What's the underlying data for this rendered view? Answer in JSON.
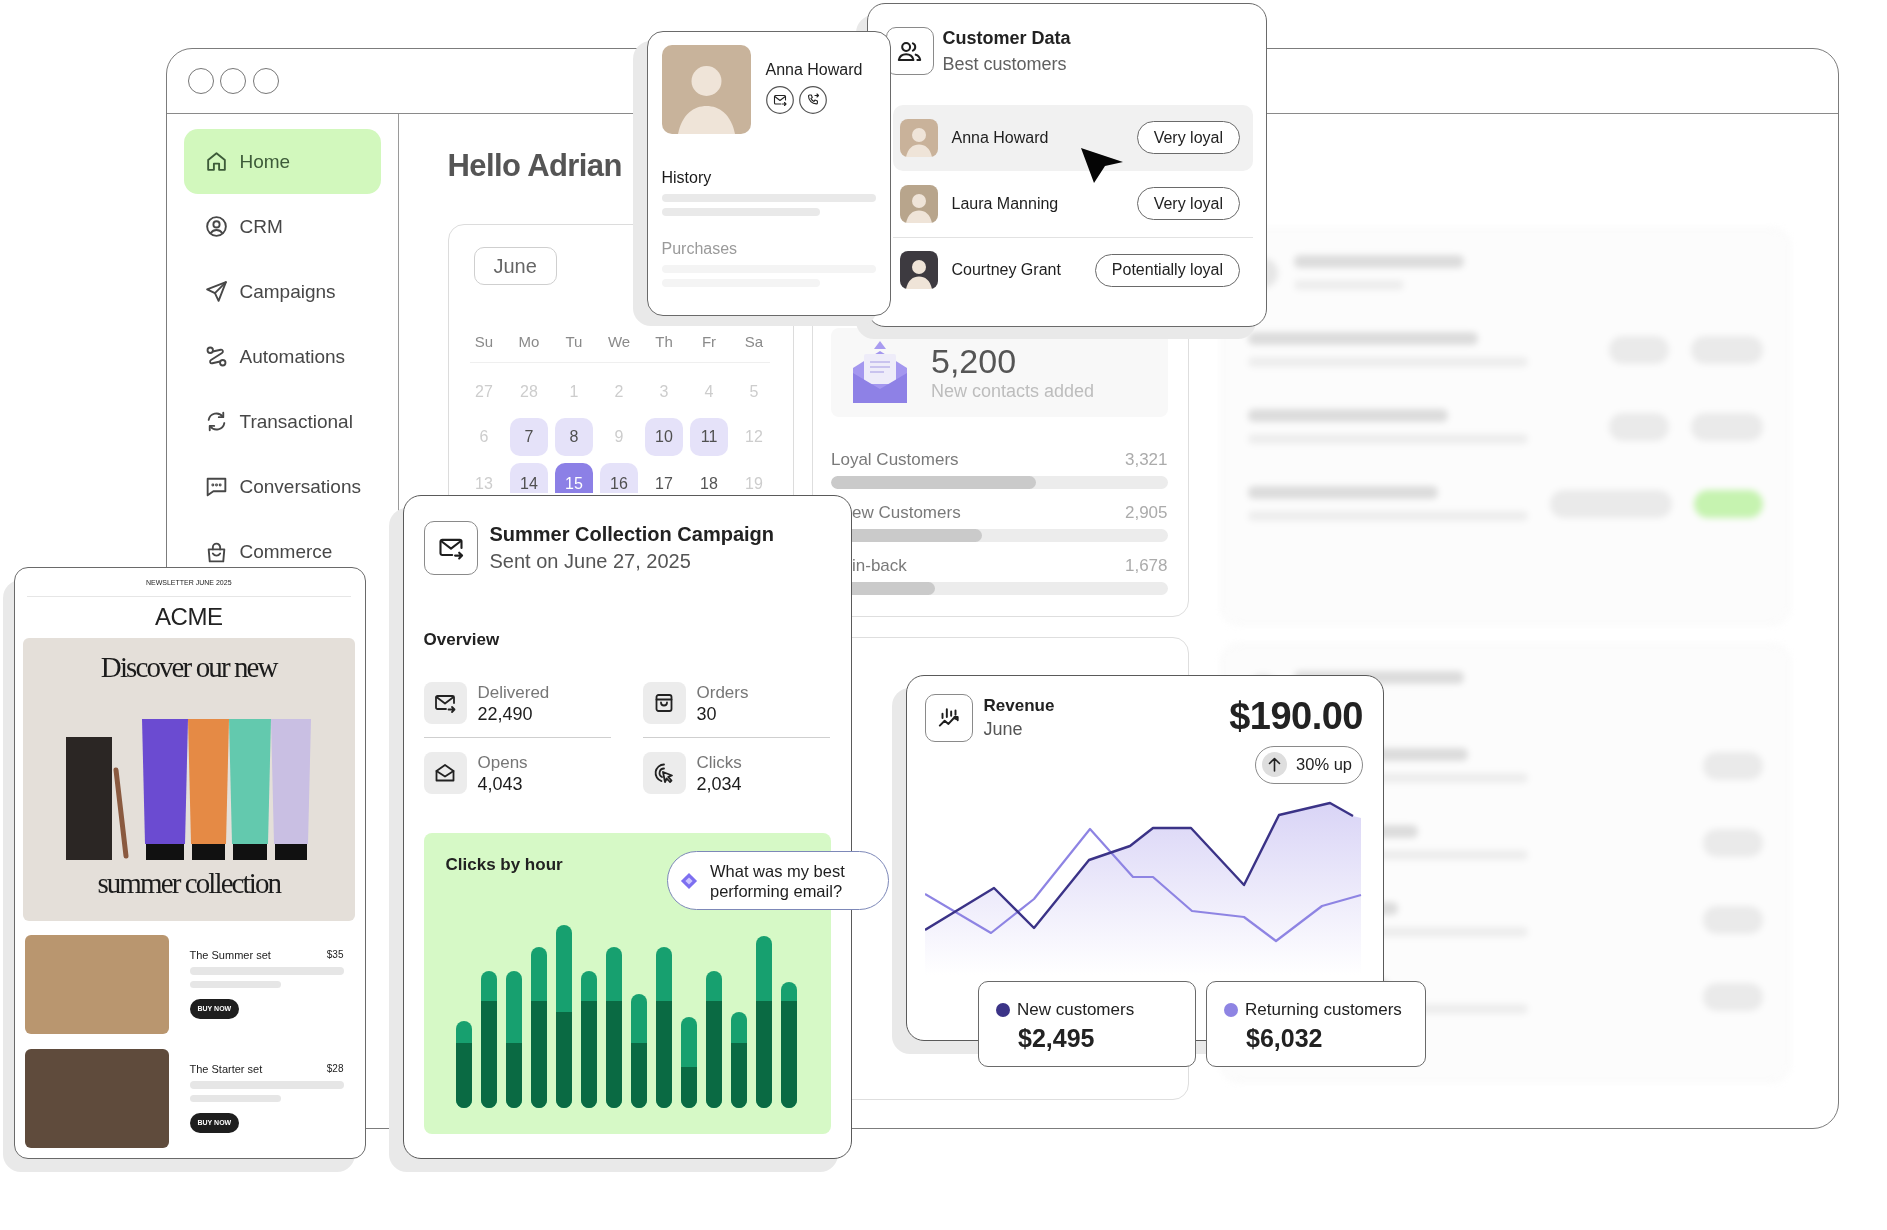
{
  "sidebar": {
    "items": [
      {
        "label": "Home",
        "selected": true
      },
      {
        "label": "CRM",
        "selected": false
      },
      {
        "label": "Campaigns",
        "selected": false
      },
      {
        "label": "Automations",
        "selected": false
      },
      {
        "label": "Transactional",
        "selected": false
      },
      {
        "label": "Conversations",
        "selected": false
      },
      {
        "label": "Commerce",
        "selected": false
      }
    ]
  },
  "dashboard": {
    "greeting": "Hello Adrian",
    "calendar": {
      "month": "June",
      "weekdays": [
        "Su",
        "Mo",
        "Tu",
        "We",
        "Th",
        "Fr",
        "Sa"
      ],
      "weeks": [
        [
          {
            "day": "27",
            "dimmed": true,
            "highlighted": false,
            "selected": false
          },
          {
            "day": "28",
            "dimmed": true,
            "highlighted": false,
            "selected": false
          },
          {
            "day": "1",
            "dimmed": true,
            "highlighted": false,
            "selected": false
          },
          {
            "day": "2",
            "dimmed": true,
            "highlighted": false,
            "selected": false
          },
          {
            "day": "3",
            "dimmed": true,
            "highlighted": false,
            "selected": false
          },
          {
            "day": "4",
            "dimmed": true,
            "highlighted": false,
            "selected": false
          },
          {
            "day": "5",
            "dimmed": true,
            "highlighted": false,
            "selected": false
          }
        ],
        [
          {
            "day": "6",
            "dimmed": true,
            "highlighted": false,
            "selected": false
          },
          {
            "day": "7",
            "dimmed": false,
            "highlighted": true,
            "selected": false
          },
          {
            "day": "8",
            "dimmed": false,
            "highlighted": true,
            "selected": false
          },
          {
            "day": "9",
            "dimmed": true,
            "highlighted": false,
            "selected": false
          },
          {
            "day": "10",
            "dimmed": false,
            "highlighted": true,
            "selected": false
          },
          {
            "day": "11",
            "dimmed": false,
            "highlighted": true,
            "selected": false
          },
          {
            "day": "12",
            "dimmed": true,
            "highlighted": false,
            "selected": false
          }
        ],
        [
          {
            "day": "13",
            "dimmed": true,
            "highlighted": false,
            "selected": false
          },
          {
            "day": "14",
            "dimmed": false,
            "highlighted": true,
            "selected": false
          },
          {
            "day": "15",
            "dimmed": false,
            "highlighted": false,
            "selected": true
          },
          {
            "day": "16",
            "dimmed": false,
            "highlighted": true,
            "selected": false
          },
          {
            "day": "17",
            "dimmed": false,
            "highlighted": false,
            "selected": false
          },
          {
            "day": "18",
            "dimmed": false,
            "highlighted": false,
            "selected": false
          },
          {
            "day": "19",
            "dimmed": true,
            "highlighted": false,
            "selected": false
          }
        ]
      ]
    },
    "contacts": {
      "value": "5,200",
      "caption": "New contacts added",
      "segments": [
        {
          "label": "Loyal Customers",
          "count": "3,321",
          "level": 0.61
        },
        {
          "label": "ew Customers",
          "count": "2,905",
          "level": 0.45
        },
        {
          "label": "in-back",
          "count": "1,678",
          "level": 0.31
        }
      ]
    }
  },
  "profile_card": {
    "name": "Anna Howard",
    "sections": [
      {
        "title": "History"
      },
      {
        "title": "Purchases"
      }
    ]
  },
  "customer_data": {
    "title": "Customer Data",
    "subtitle": "Best customers",
    "customers": [
      {
        "name": "Anna Howard",
        "badge": "Very loyal",
        "selected": true
      },
      {
        "name": "Laura Manning",
        "badge": "Very loyal",
        "selected": false
      },
      {
        "name": "Courtney Grant",
        "badge": "Potentially loyal",
        "selected": false
      }
    ]
  },
  "campaign": {
    "title": "Summer Collection Campaign",
    "subtitle": "Sent on June 27, 2025",
    "overview_title": "Overview",
    "metrics": [
      {
        "label": "Delivered",
        "value": "22,490"
      },
      {
        "label": "Orders",
        "value": "30"
      },
      {
        "label": "Opens",
        "value": "4,043"
      },
      {
        "label": "Clicks",
        "value": "2,034"
      }
    ],
    "chart_title": "Clicks by hour"
  },
  "assistant_prompt": {
    "text": "What was my best performing email?"
  },
  "revenue": {
    "title": "Revenue",
    "period": "June",
    "total": "$190.00",
    "change": "30% up",
    "legend": [
      {
        "label": "New customers",
        "value": "$2,495",
        "color": "#3b3387"
      },
      {
        "label": "Returning customers",
        "value": "$6,032",
        "color": "#8e84e3"
      }
    ]
  },
  "newsletter": {
    "kicker": "NEWSLETTER JUNE 2025",
    "brand": "ACME",
    "headline_top": "Discover our new",
    "headline_bottom": "summer collection",
    "products": [
      {
        "name": "The Summer set",
        "price": "$35",
        "button": "BUY NOW"
      },
      {
        "name": "The Starter set",
        "price": "$28",
        "button": "BUY NOW"
      }
    ]
  }
}
